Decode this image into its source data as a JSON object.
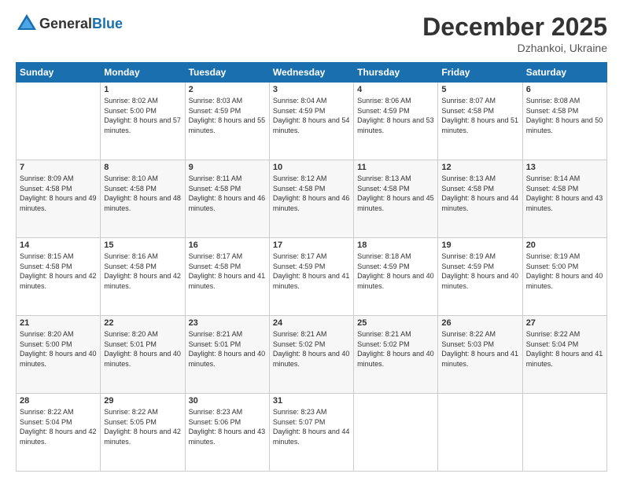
{
  "header": {
    "logo_general": "General",
    "logo_blue": "Blue",
    "month": "December 2025",
    "location": "Dzhankoi, Ukraine"
  },
  "weekdays": [
    "Sunday",
    "Monday",
    "Tuesday",
    "Wednesday",
    "Thursday",
    "Friday",
    "Saturday"
  ],
  "weeks": [
    [
      {
        "day": "",
        "sunrise": "",
        "sunset": "",
        "daylight": ""
      },
      {
        "day": "1",
        "sunrise": "Sunrise: 8:02 AM",
        "sunset": "Sunset: 5:00 PM",
        "daylight": "Daylight: 8 hours and 57 minutes."
      },
      {
        "day": "2",
        "sunrise": "Sunrise: 8:03 AM",
        "sunset": "Sunset: 4:59 PM",
        "daylight": "Daylight: 8 hours and 55 minutes."
      },
      {
        "day": "3",
        "sunrise": "Sunrise: 8:04 AM",
        "sunset": "Sunset: 4:59 PM",
        "daylight": "Daylight: 8 hours and 54 minutes."
      },
      {
        "day": "4",
        "sunrise": "Sunrise: 8:06 AM",
        "sunset": "Sunset: 4:59 PM",
        "daylight": "Daylight: 8 hours and 53 minutes."
      },
      {
        "day": "5",
        "sunrise": "Sunrise: 8:07 AM",
        "sunset": "Sunset: 4:58 PM",
        "daylight": "Daylight: 8 hours and 51 minutes."
      },
      {
        "day": "6",
        "sunrise": "Sunrise: 8:08 AM",
        "sunset": "Sunset: 4:58 PM",
        "daylight": "Daylight: 8 hours and 50 minutes."
      }
    ],
    [
      {
        "day": "7",
        "sunrise": "Sunrise: 8:09 AM",
        "sunset": "Sunset: 4:58 PM",
        "daylight": "Daylight: 8 hours and 49 minutes."
      },
      {
        "day": "8",
        "sunrise": "Sunrise: 8:10 AM",
        "sunset": "Sunset: 4:58 PM",
        "daylight": "Daylight: 8 hours and 48 minutes."
      },
      {
        "day": "9",
        "sunrise": "Sunrise: 8:11 AM",
        "sunset": "Sunset: 4:58 PM",
        "daylight": "Daylight: 8 hours and 46 minutes."
      },
      {
        "day": "10",
        "sunrise": "Sunrise: 8:12 AM",
        "sunset": "Sunset: 4:58 PM",
        "daylight": "Daylight: 8 hours and 46 minutes."
      },
      {
        "day": "11",
        "sunrise": "Sunrise: 8:13 AM",
        "sunset": "Sunset: 4:58 PM",
        "daylight": "Daylight: 8 hours and 45 minutes."
      },
      {
        "day": "12",
        "sunrise": "Sunrise: 8:13 AM",
        "sunset": "Sunset: 4:58 PM",
        "daylight": "Daylight: 8 hours and 44 minutes."
      },
      {
        "day": "13",
        "sunrise": "Sunrise: 8:14 AM",
        "sunset": "Sunset: 4:58 PM",
        "daylight": "Daylight: 8 hours and 43 minutes."
      }
    ],
    [
      {
        "day": "14",
        "sunrise": "Sunrise: 8:15 AM",
        "sunset": "Sunset: 4:58 PM",
        "daylight": "Daylight: 8 hours and 42 minutes."
      },
      {
        "day": "15",
        "sunrise": "Sunrise: 8:16 AM",
        "sunset": "Sunset: 4:58 PM",
        "daylight": "Daylight: 8 hours and 42 minutes."
      },
      {
        "day": "16",
        "sunrise": "Sunrise: 8:17 AM",
        "sunset": "Sunset: 4:58 PM",
        "daylight": "Daylight: 8 hours and 41 minutes."
      },
      {
        "day": "17",
        "sunrise": "Sunrise: 8:17 AM",
        "sunset": "Sunset: 4:59 PM",
        "daylight": "Daylight: 8 hours and 41 minutes."
      },
      {
        "day": "18",
        "sunrise": "Sunrise: 8:18 AM",
        "sunset": "Sunset: 4:59 PM",
        "daylight": "Daylight: 8 hours and 40 minutes."
      },
      {
        "day": "19",
        "sunrise": "Sunrise: 8:19 AM",
        "sunset": "Sunset: 4:59 PM",
        "daylight": "Daylight: 8 hours and 40 minutes."
      },
      {
        "day": "20",
        "sunrise": "Sunrise: 8:19 AM",
        "sunset": "Sunset: 5:00 PM",
        "daylight": "Daylight: 8 hours and 40 minutes."
      }
    ],
    [
      {
        "day": "21",
        "sunrise": "Sunrise: 8:20 AM",
        "sunset": "Sunset: 5:00 PM",
        "daylight": "Daylight: 8 hours and 40 minutes."
      },
      {
        "day": "22",
        "sunrise": "Sunrise: 8:20 AM",
        "sunset": "Sunset: 5:01 PM",
        "daylight": "Daylight: 8 hours and 40 minutes."
      },
      {
        "day": "23",
        "sunrise": "Sunrise: 8:21 AM",
        "sunset": "Sunset: 5:01 PM",
        "daylight": "Daylight: 8 hours and 40 minutes."
      },
      {
        "day": "24",
        "sunrise": "Sunrise: 8:21 AM",
        "sunset": "Sunset: 5:02 PM",
        "daylight": "Daylight: 8 hours and 40 minutes."
      },
      {
        "day": "25",
        "sunrise": "Sunrise: 8:21 AM",
        "sunset": "Sunset: 5:02 PM",
        "daylight": "Daylight: 8 hours and 40 minutes."
      },
      {
        "day": "26",
        "sunrise": "Sunrise: 8:22 AM",
        "sunset": "Sunset: 5:03 PM",
        "daylight": "Daylight: 8 hours and 41 minutes."
      },
      {
        "day": "27",
        "sunrise": "Sunrise: 8:22 AM",
        "sunset": "Sunset: 5:04 PM",
        "daylight": "Daylight: 8 hours and 41 minutes."
      }
    ],
    [
      {
        "day": "28",
        "sunrise": "Sunrise: 8:22 AM",
        "sunset": "Sunset: 5:04 PM",
        "daylight": "Daylight: 8 hours and 42 minutes."
      },
      {
        "day": "29",
        "sunrise": "Sunrise: 8:22 AM",
        "sunset": "Sunset: 5:05 PM",
        "daylight": "Daylight: 8 hours and 42 minutes."
      },
      {
        "day": "30",
        "sunrise": "Sunrise: 8:23 AM",
        "sunset": "Sunset: 5:06 PM",
        "daylight": "Daylight: 8 hours and 43 minutes."
      },
      {
        "day": "31",
        "sunrise": "Sunrise: 8:23 AM",
        "sunset": "Sunset: 5:07 PM",
        "daylight": "Daylight: 8 hours and 44 minutes."
      },
      {
        "day": "",
        "sunrise": "",
        "sunset": "",
        "daylight": ""
      },
      {
        "day": "",
        "sunrise": "",
        "sunset": "",
        "daylight": ""
      },
      {
        "day": "",
        "sunrise": "",
        "sunset": "",
        "daylight": ""
      }
    ]
  ]
}
